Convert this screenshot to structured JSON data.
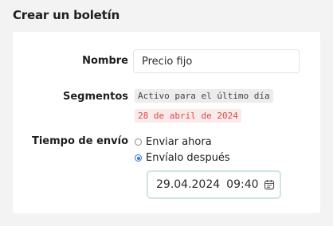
{
  "page": {
    "title": "Crear un boletín"
  },
  "form": {
    "name_label": "Nombre",
    "name_value": "Precio fijo",
    "segments_label": "Segmentos",
    "segment_tag": "Activo para el último día",
    "segment_date_tag": "28 de abril de 2024",
    "send_time_label": "Tiempo de envío",
    "send_options": [
      {
        "label": "Enviar ahora",
        "selected": false
      },
      {
        "label": "Envíalo después",
        "selected": true
      }
    ],
    "date_value": "29.04.2024",
    "time_value": "09:40"
  },
  "colors": {
    "accent": "#2f6fd6",
    "tag_red_text": "#d94a4a",
    "date_border": "#cfe7dc"
  },
  "icons": [
    "calendar-icon"
  ]
}
